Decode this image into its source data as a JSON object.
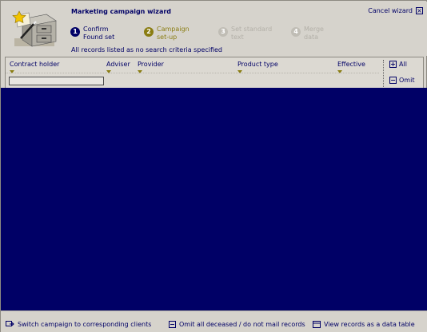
{
  "wizard": {
    "title": "Marketing campaign wizard",
    "cancel_label": "Cancel wizard",
    "notice": "All records listed as no search criteria specified"
  },
  "steps": [
    {
      "number": "1",
      "line1": "Confirm",
      "line2": "Found set",
      "state": "active"
    },
    {
      "number": "2",
      "line1": "Campaign",
      "line2": "set-up",
      "state": "next"
    },
    {
      "number": "3",
      "line1": "Set standard",
      "line2": "text",
      "state": "disabled"
    },
    {
      "number": "4",
      "line1": "Merge",
      "line2": "data",
      "state": "disabled"
    }
  ],
  "grid": {
    "columns": [
      "Contract holder",
      "Adviser",
      "Provider",
      "Product type",
      "Effective"
    ],
    "all_label": "All",
    "omit_label": "Omit",
    "filter_value": ""
  },
  "footer": {
    "switch_label": "Switch campaign to corresponding clients",
    "omit_deceased_label": "Omit all deceased / do not mail records",
    "view_table_label": "View records as a data table"
  },
  "colors": {
    "accent": "#000066",
    "step_next": "#8a7d12",
    "disabled": "#b3b0a8",
    "background": "#d6d3cc"
  }
}
